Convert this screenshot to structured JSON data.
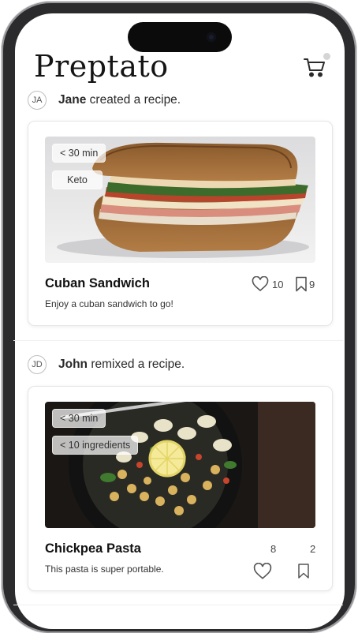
{
  "app": {
    "title": "Preptato"
  },
  "feed": [
    {
      "avatar": "JA",
      "user": "Jane",
      "action": "created a recipe.",
      "tags": [
        "< 30 min",
        "Keto"
      ],
      "recipe_title": "Cuban Sandwich",
      "recipe_desc": "Enjoy a cuban sandwich to go!",
      "likes": "10",
      "saves": "9"
    },
    {
      "avatar": "JD",
      "user": "John",
      "action": "remixed a recipe.",
      "tags": [
        "< 30 min",
        "< 10 ingredients"
      ],
      "recipe_title": "Chickpea Pasta",
      "recipe_desc": "This pasta is super portable.",
      "likes": "8",
      "saves": "2"
    }
  ],
  "icons": {
    "cart": "shopping-cart-icon",
    "like": "heart-icon",
    "save": "bookmark-icon"
  }
}
